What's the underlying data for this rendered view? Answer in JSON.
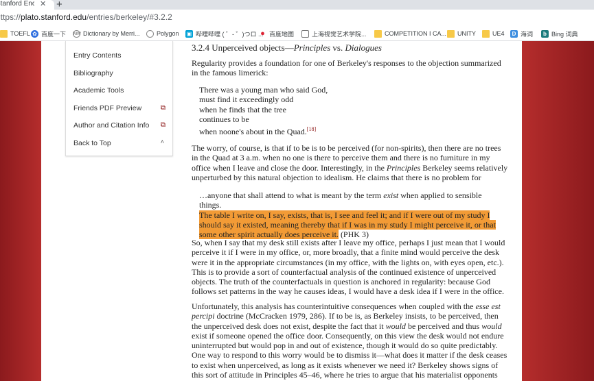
{
  "browser": {
    "tab_title": "Stanford Encyc",
    "tab_close": "✕",
    "newtab": "+",
    "url_scheme": "https://",
    "url_host": "plato.stanford.edu",
    "url_path": "/entries/berkeley/#3.2.2"
  },
  "bookmarks": [
    {
      "label": "TOEFL",
      "icon": "folder-icon"
    },
    {
      "label": "百度一下",
      "icon": "baidu-paw-icon"
    },
    {
      "label": "Dictionary by Merri...",
      "icon": "merriam-webster-icon"
    },
    {
      "label": "Polygon",
      "icon": "polygon-icon"
    },
    {
      "label": "哔哩哔哩 ( ゜- ゜)つロ ...",
      "icon": "bilibili-icon"
    },
    {
      "label": "百度地图",
      "icon": "map-pin-icon"
    },
    {
      "label": "上海视觉艺术学院...",
      "icon": "page-icon"
    },
    {
      "label": "COMPETITION I CA...",
      "icon": "folder-icon"
    },
    {
      "label": "UNITY",
      "icon": "folder-icon"
    },
    {
      "label": "UE4",
      "icon": "folder-icon"
    },
    {
      "label": "海词",
      "icon": "dict-d-icon"
    },
    {
      "label": "Bing 词典",
      "icon": "bing-icon"
    }
  ],
  "sidebar": {
    "items": [
      {
        "label": "Entry Contents"
      },
      {
        "label": "Bibliography"
      },
      {
        "label": "Academic Tools"
      },
      {
        "label": "Friends PDF Preview",
        "ext": "⧉"
      },
      {
        "label": "Author and Citation Info",
        "ext": "⧉"
      },
      {
        "label": "Back to Top",
        "caret": "˄"
      }
    ]
  },
  "article": {
    "heading_prefix": "3.2.4 Unperceived objects—",
    "heading_italic1": "Principles",
    "heading_mid": " vs. ",
    "heading_italic2": "Dialogues",
    "p1": "Regularity provides a foundation for one of Berkeley's responses to the objection summarized in the famous limerick:",
    "verse": [
      "There was a young man who said God,",
      "must find it exceedingly odd",
      "when he finds that the tree",
      "continues to be",
      "when noone's about in the Quad."
    ],
    "verse_note": "[18]",
    "p2_a": "The worry, of course, is that if to be is to be perceived (for non-spirits), then there are no trees in the Quad at 3 a.m. when no one is there to perceive them and there is no furniture in my office when I leave and close the door. Interestingly, in the ",
    "p2_i": "Principles",
    "p2_b": " Berkeley seems relatively unperturbed by this natural objection to idealism. He claims that there is no problem for",
    "quote_a": "…anyone that shall attend to what is meant by the term ",
    "quote_i": "exist",
    "quote_b": " when applied to sensible things.",
    "quote_hl": "The table I write on, I say, exists, that is, I see and feel it; and if I were out of my study I should say it existed, meaning thereby that if I was in my study I might perceive it, or that some other spirit actually does perceive it.",
    "quote_ref": " (PHK 3)",
    "p3": "So, when I say that my desk still exists after I leave my office, perhaps I just mean that I would perceive it if I were in my office, or, more broadly, that a finite mind would perceive the desk were it in the appropriate circumstances (in my office, with the lights on, with eyes open, etc.). This is to provide a sort of counterfactual analysis of the continued existence of unperceived objects. The truth of the counterfactuals in question is anchored in regularity: because God follows set patterns in the way he causes ideas, I would have a desk idea if I were in the office.",
    "p4_a": "Unfortunately, this analysis has counterintuitive consequences when coupled with the ",
    "p4_i1": "esse est percipi",
    "p4_b": " doctrine (McCracken 1979, 286). If to be is, as Berkeley insists, to be perceived, then the unperceived desk does not exist, despite the fact that it ",
    "p4_i2": "would",
    "p4_c": " be perceived and thus ",
    "p4_i3": "would",
    "p4_d": " exist if someone opened the office door. Consequently, on this view the desk would not endure uninterrupted but would pop in and out of existence, though it would do so quite predictably. One way to respond to this worry would be to dismiss it—what does it matter if the desk ceases to exist when unperceived, as long as it exists whenever we need it? Berkeley shows signs of this sort of attitude in Principles 45–46, where he tries to argue that his materialist opponents and scholastic"
  }
}
